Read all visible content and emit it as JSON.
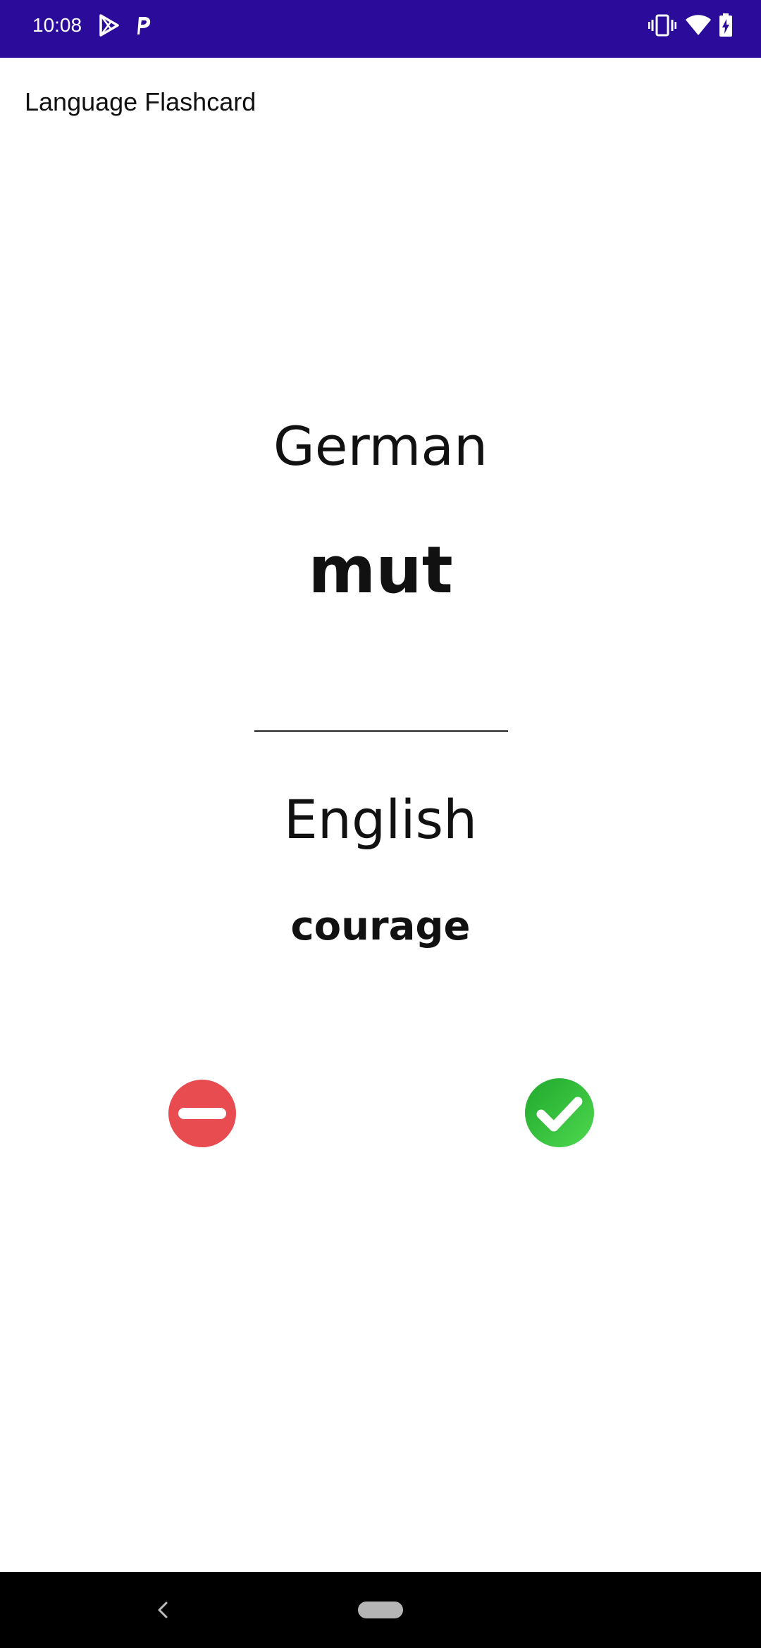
{
  "status_bar": {
    "time": "10:08",
    "left_icons": [
      "play-store-icon",
      "parking-p-icon"
    ],
    "right_icons": [
      "vibrate-icon",
      "wifi-icon",
      "battery-charging-icon"
    ],
    "background_color": "#2a0b9a"
  },
  "app": {
    "title": "Language Flashcard"
  },
  "card": {
    "source_language": "German",
    "source_word": "mut",
    "target_language": "English",
    "target_word": "courage"
  },
  "actions": {
    "wrong_icon": "minus-circle-icon",
    "wrong_color": "#e84b50",
    "right_icon": "check-circle-icon",
    "right_color": "#2fbf3a"
  },
  "nav_bar": {
    "icons": [
      "back-icon",
      "home-pill-icon"
    ]
  }
}
